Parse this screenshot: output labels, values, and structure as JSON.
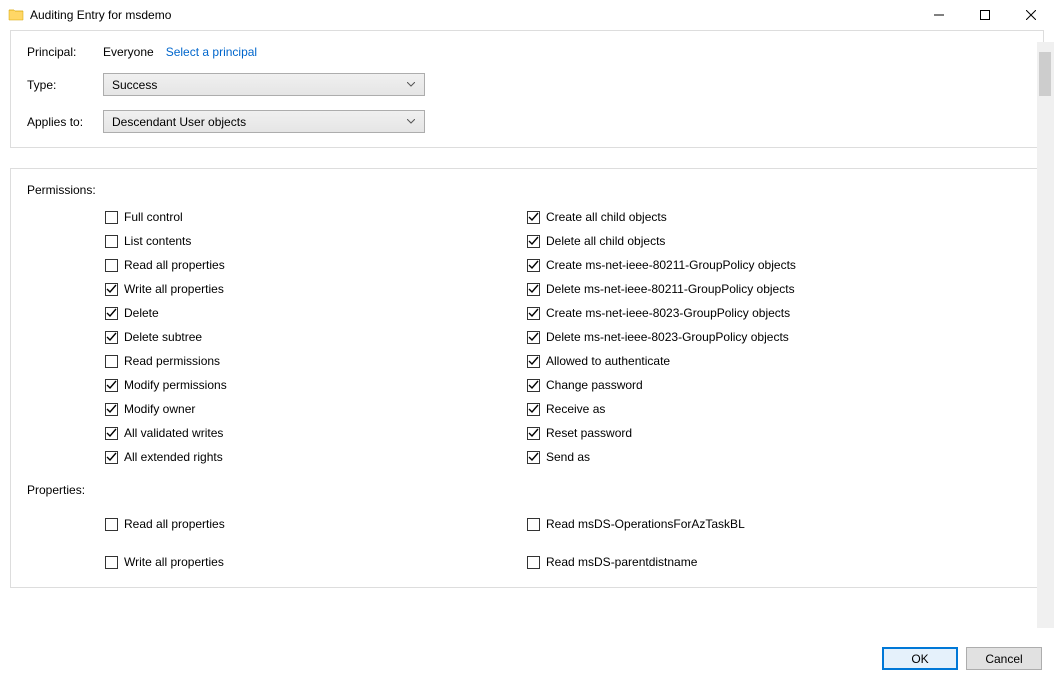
{
  "window": {
    "title": "Auditing Entry for msdemo"
  },
  "header": {
    "principal_label": "Principal:",
    "principal_value": "Everyone",
    "select_principal_link": "Select a principal",
    "type_label": "Type:",
    "type_value": "Success",
    "applies_label": "Applies to:",
    "applies_value": "Descendant User objects"
  },
  "sections": {
    "permissions_label": "Permissions:",
    "properties_label": "Properties:"
  },
  "permissions_left": [
    {
      "label": "Full control",
      "checked": false
    },
    {
      "label": "List contents",
      "checked": false
    },
    {
      "label": "Read all properties",
      "checked": false
    },
    {
      "label": "Write all properties",
      "checked": true
    },
    {
      "label": "Delete",
      "checked": true
    },
    {
      "label": "Delete subtree",
      "checked": true
    },
    {
      "label": "Read permissions",
      "checked": false
    },
    {
      "label": "Modify permissions",
      "checked": true
    },
    {
      "label": "Modify owner",
      "checked": true
    },
    {
      "label": "All validated writes",
      "checked": true
    },
    {
      "label": "All extended rights",
      "checked": true
    }
  ],
  "permissions_right": [
    {
      "label": "Create all child objects",
      "checked": true
    },
    {
      "label": "Delete all child objects",
      "checked": true
    },
    {
      "label": "Create ms-net-ieee-80211-GroupPolicy objects",
      "checked": true
    },
    {
      "label": "Delete ms-net-ieee-80211-GroupPolicy objects",
      "checked": true
    },
    {
      "label": "Create ms-net-ieee-8023-GroupPolicy objects",
      "checked": true
    },
    {
      "label": "Delete ms-net-ieee-8023-GroupPolicy objects",
      "checked": true
    },
    {
      "label": "Allowed to authenticate",
      "checked": true
    },
    {
      "label": "Change password",
      "checked": true
    },
    {
      "label": "Receive as",
      "checked": true
    },
    {
      "label": "Reset password",
      "checked": true
    },
    {
      "label": "Send as",
      "checked": true
    }
  ],
  "properties_left": [
    {
      "label": "Read all properties",
      "checked": false
    },
    {
      "label": "Write all properties",
      "checked": false
    }
  ],
  "properties_right": [
    {
      "label": "Read msDS-OperationsForAzTaskBL",
      "checked": false
    },
    {
      "label": "Read msDS-parentdistname",
      "checked": false
    }
  ],
  "buttons": {
    "ok": "OK",
    "cancel": "Cancel"
  }
}
